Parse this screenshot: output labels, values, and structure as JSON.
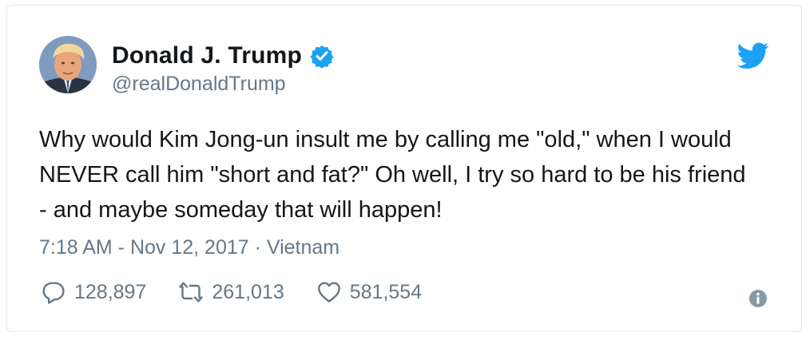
{
  "tweet": {
    "display_name": "Donald J. Trump",
    "handle": "@realDonaldTrump",
    "text": "Why would Kim Jong-un insult me by calling me \"old,\" when I would NEVER call him \"short and fat?\" Oh well, I try so hard to be his friend - and maybe someday that will happen!",
    "timestamp": "7:18 AM - Nov 12, 2017 · Vietnam"
  },
  "actions": {
    "reply_count": "128,897",
    "retweet_count": "261,013",
    "like_count": "581,554"
  },
  "icons": {
    "verified": "verified-badge-icon",
    "logo": "twitter-bird-icon",
    "reply": "reply-icon",
    "retweet": "retweet-icon",
    "like": "heart-icon",
    "info": "info-icon"
  },
  "colors": {
    "brand_blue": "#1da1f2",
    "text": "#14171a",
    "muted": "#657786",
    "border": "#e1e8ed"
  }
}
